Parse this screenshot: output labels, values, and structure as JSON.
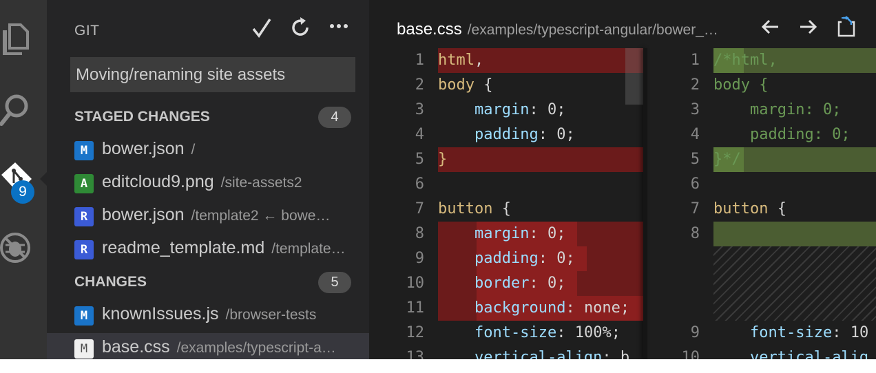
{
  "sidebar": {
    "title": "GIT",
    "badge_count": "9",
    "commit_message": "Moving/renaming site assets",
    "staged": {
      "label": "STAGED CHANGES",
      "count": "4",
      "files": [
        {
          "status": "M",
          "name": "bower.json",
          "path": "/"
        },
        {
          "status": "A",
          "name": "editcloud9.png",
          "path": "/site-assets2"
        },
        {
          "status": "R",
          "name": "bower.json",
          "path": "/template2 ← bowe…"
        },
        {
          "status": "R",
          "name": "readme_template.md",
          "path": "/template…"
        }
      ]
    },
    "changes": {
      "label": "CHANGES",
      "count": "5",
      "files": [
        {
          "status": "M",
          "name": "knownIssues.js",
          "path": "/browser-tests"
        },
        {
          "status": "M",
          "name": "base.css",
          "path": "/examples/typescript-a…"
        }
      ]
    }
  },
  "editor": {
    "file_name": "base.css",
    "file_path": "/examples/typescript-angular/bower_…",
    "left_lines": [
      {
        "n": "1",
        "parts": [
          [
            "sel",
            "html"
          ],
          [
            "pun",
            ","
          ]
        ]
      },
      {
        "n": "2",
        "parts": [
          [
            "sel",
            "body"
          ],
          [
            "pun",
            " {"
          ]
        ]
      },
      {
        "n": "3",
        "parts": [
          [
            "pun",
            "    "
          ],
          [
            "prop",
            "margin"
          ],
          [
            "pun",
            ": "
          ],
          [
            "val",
            "0"
          ],
          [
            "pun",
            ";"
          ]
        ]
      },
      {
        "n": "4",
        "parts": [
          [
            "pun",
            "    "
          ],
          [
            "prop",
            "padding"
          ],
          [
            "pun",
            ": "
          ],
          [
            "val",
            "0"
          ],
          [
            "pun",
            ";"
          ]
        ]
      },
      {
        "n": "5",
        "parts": [
          [
            "sel",
            "}"
          ]
        ]
      },
      {
        "n": "6",
        "parts": []
      },
      {
        "n": "7",
        "parts": [
          [
            "sel",
            "button"
          ],
          [
            "pun",
            " {"
          ]
        ]
      },
      {
        "n": "8",
        "parts": [
          [
            "pun",
            "    "
          ],
          [
            "prop",
            "margin"
          ],
          [
            "pun",
            ": "
          ],
          [
            "val",
            "0"
          ],
          [
            "pun",
            ";"
          ]
        ]
      },
      {
        "n": "9",
        "parts": [
          [
            "pun",
            "    "
          ],
          [
            "prop",
            "padding"
          ],
          [
            "pun",
            ": "
          ],
          [
            "val",
            "0"
          ],
          [
            "pun",
            ";"
          ]
        ]
      },
      {
        "n": "10",
        "parts": [
          [
            "pun",
            "    "
          ],
          [
            "prop",
            "border"
          ],
          [
            "pun",
            ": "
          ],
          [
            "val",
            "0"
          ],
          [
            "pun",
            ";"
          ]
        ]
      },
      {
        "n": "11",
        "parts": [
          [
            "pun",
            "    "
          ],
          [
            "prop",
            "background"
          ],
          [
            "pun",
            ": "
          ],
          [
            "val",
            "none"
          ],
          [
            "pun",
            ";"
          ]
        ]
      },
      {
        "n": "12",
        "parts": [
          [
            "pun",
            "    "
          ],
          [
            "prop",
            "font-size"
          ],
          [
            "pun",
            ": "
          ],
          [
            "val",
            "100%"
          ],
          [
            "pun",
            ";"
          ]
        ]
      },
      {
        "n": "13",
        "parts": [
          [
            "pun",
            "    "
          ],
          [
            "prop",
            "vertical-align"
          ],
          [
            "pun",
            ": "
          ],
          [
            "val",
            "b"
          ]
        ]
      }
    ],
    "right_lines": [
      {
        "n": "1",
        "parts": [
          [
            "cmt",
            "/*html,"
          ]
        ]
      },
      {
        "n": "2",
        "parts": [
          [
            "cmt",
            "body {"
          ]
        ]
      },
      {
        "n": "3",
        "parts": [
          [
            "cmt",
            "    margin: 0;"
          ]
        ]
      },
      {
        "n": "4",
        "parts": [
          [
            "cmt",
            "    padding: 0;"
          ]
        ]
      },
      {
        "n": "5",
        "parts": [
          [
            "cmt",
            "}*/"
          ]
        ]
      },
      {
        "n": "6",
        "parts": []
      },
      {
        "n": "7",
        "parts": [
          [
            "sel",
            "button"
          ],
          [
            "pun",
            " {"
          ]
        ]
      },
      {
        "n": "8",
        "parts": []
      },
      {
        "n": "9",
        "parts": [
          [
            "pun",
            "    "
          ],
          [
            "prop",
            "font-size"
          ],
          [
            "pun",
            ": "
          ],
          [
            "val",
            "10"
          ]
        ]
      },
      {
        "n": "10",
        "parts": [
          [
            "pun",
            "    "
          ],
          [
            "prop",
            "vertical-alig"
          ]
        ]
      }
    ]
  }
}
